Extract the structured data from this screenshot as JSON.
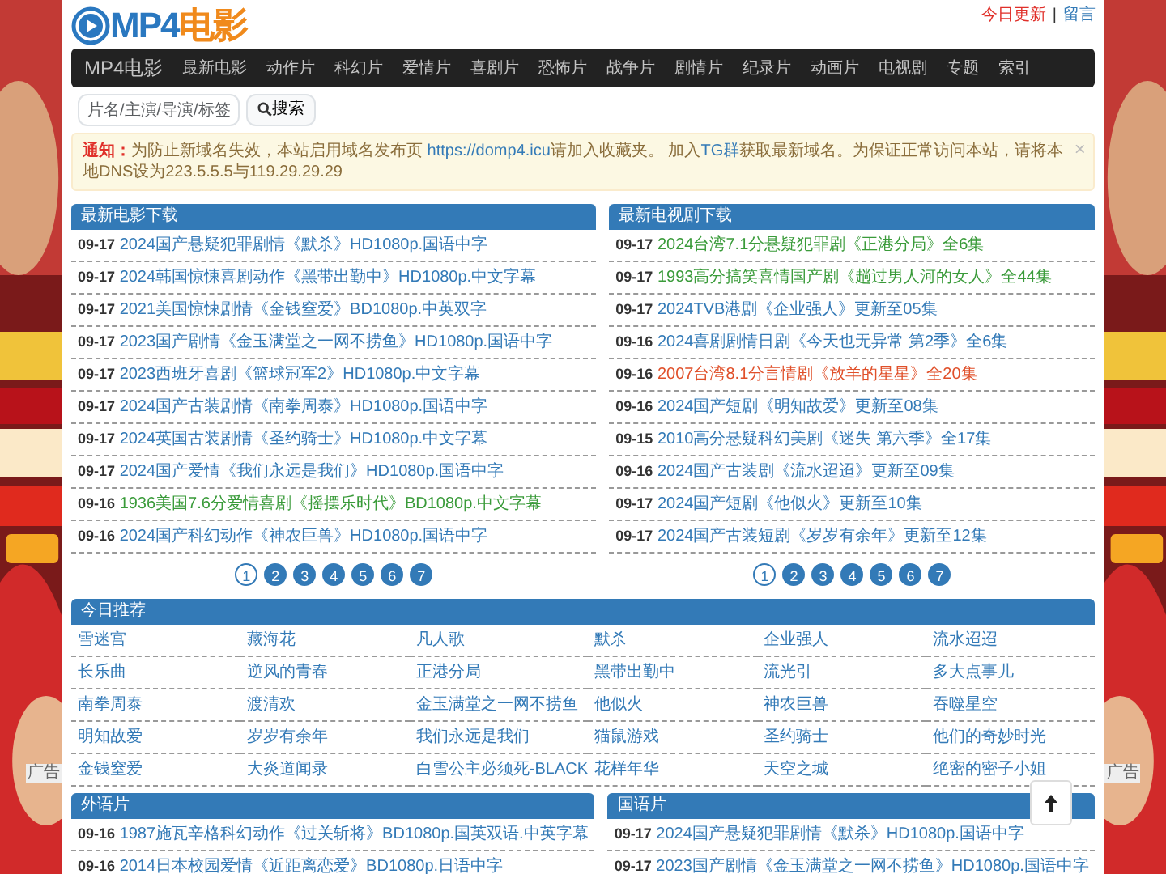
{
  "logo": {
    "text_a": "MP4",
    "text_b": "电影"
  },
  "top_links": [
    {
      "label": "今日更新",
      "color": "#e0302a"
    },
    {
      "label": "留言",
      "color": "#337ab7"
    }
  ],
  "top_separator": "|",
  "navbar": {
    "brand": "MP4电影",
    "items": [
      "最新电影",
      "动作片",
      "科幻片",
      "爱情片",
      "喜剧片",
      "恐怖片",
      "战争片",
      "剧情片",
      "纪录片",
      "动画片",
      "电视剧",
      "专题",
      "索引"
    ]
  },
  "search": {
    "placeholder": "片名/主演/导演/标签",
    "button": "搜索"
  },
  "notice": {
    "close": "×",
    "parts": [
      {
        "kind": "label",
        "text": "通知："
      },
      {
        "kind": "text",
        "text": "为防止新域名失效，本站启用域名发布页 "
      },
      {
        "kind": "link",
        "text": "https://domp4.icu"
      },
      {
        "kind": "text",
        "text": "请加入收藏夹。 加入"
      },
      {
        "kind": "link",
        "text": "TG群"
      },
      {
        "kind": "text",
        "text": "获取最新域名。为保证正常访问本站，请将本地DNS设为223.5.5.5与119.29.29.29"
      }
    ]
  },
  "movies": {
    "title": "最新电影下载",
    "rows": [
      {
        "date": "09-17",
        "title": "2024国产悬疑犯罪剧情《默杀》HD1080p.国语中字",
        "color": "#337ab7"
      },
      {
        "date": "09-17",
        "title": "2024韩国惊悚喜剧动作《黑带出勤中》HD1080p.中文字幕",
        "color": "#337ab7"
      },
      {
        "date": "09-17",
        "title": "2021美国惊悚剧情《金钱窒爱》BD1080p.中英双字",
        "color": "#337ab7"
      },
      {
        "date": "09-17",
        "title": "2023国产剧情《金玉满堂之一网不捞鱼》HD1080p.国语中字",
        "color": "#337ab7"
      },
      {
        "date": "09-17",
        "title": "2023西班牙喜剧《篮球冠军2》HD1080p.中文字幕",
        "color": "#337ab7"
      },
      {
        "date": "09-17",
        "title": "2024国产古装剧情《南拳周泰》HD1080p.国语中字",
        "color": "#337ab7"
      },
      {
        "date": "09-17",
        "title": "2024英国古装剧情《圣约骑士》HD1080p.中文字幕",
        "color": "#337ab7"
      },
      {
        "date": "09-17",
        "title": "2024国产爱情《我们永远是我们》HD1080p.国语中字",
        "color": "#337ab7"
      },
      {
        "date": "09-16",
        "title": "1936美国7.6分爱情喜剧《摇摆乐时代》BD1080p.中文字幕",
        "color": "#3a9b3a"
      },
      {
        "date": "09-16",
        "title": "2024国产科幻动作《神农巨兽》HD1080p.国语中字",
        "color": "#337ab7"
      }
    ],
    "pages": [
      {
        "label": "1",
        "selected": true
      },
      {
        "label": "2",
        "selected": false
      },
      {
        "label": "3",
        "selected": false
      },
      {
        "label": "4",
        "selected": false
      },
      {
        "label": "5",
        "selected": false
      },
      {
        "label": "6",
        "selected": false
      },
      {
        "label": "7",
        "selected": false
      }
    ]
  },
  "tv": {
    "title": "最新电视剧下载",
    "rows": [
      {
        "date": "09-17",
        "title": "2024台湾7.1分悬疑犯罪剧《正港分局》全6集",
        "color": "#3a9b3a"
      },
      {
        "date": "09-17",
        "title": "1993高分搞笑喜情国产剧《趟过男人河的女人》全44集",
        "color": "#3a9b3a"
      },
      {
        "date": "09-17",
        "title": "2024TVB港剧《企业强人》更新至05集",
        "color": "#337ab7"
      },
      {
        "date": "09-16",
        "title": "2024喜剧剧情日剧《今天也无异常 第2季》全6集",
        "color": "#337ab7"
      },
      {
        "date": "09-16",
        "title": "2007台湾8.1分言情剧《放羊的星星》全20集",
        "color": "#e0502a"
      },
      {
        "date": "09-16",
        "title": "2024国产短剧《明知故爱》更新至08集",
        "color": "#337ab7"
      },
      {
        "date": "09-15",
        "title": "2010高分悬疑科幻美剧《迷失 第六季》全17集",
        "color": "#337ab7"
      },
      {
        "date": "09-16",
        "title": "2024国产古装剧《流水迢迢》更新至09集",
        "color": "#337ab7"
      },
      {
        "date": "09-17",
        "title": "2024国产短剧《他似火》更新至10集",
        "color": "#337ab7"
      },
      {
        "date": "09-17",
        "title": "2024国产古装短剧《岁岁有余年》更新至12集",
        "color": "#337ab7"
      }
    ],
    "pages": [
      {
        "label": "1",
        "selected": true
      },
      {
        "label": "2",
        "selected": false
      },
      {
        "label": "3",
        "selected": false
      },
      {
        "label": "4",
        "selected": false
      },
      {
        "label": "5",
        "selected": false
      },
      {
        "label": "6",
        "selected": false
      },
      {
        "label": "7",
        "selected": false
      }
    ]
  },
  "today": {
    "title": "今日推荐",
    "items": [
      "雪迷宫",
      "藏海花",
      "凡人歌",
      "默杀",
      "企业强人",
      "流水迢迢",
      "长乐曲",
      "逆风的青春",
      "正港分局",
      "黑带出勤中",
      "流光引",
      "多大点事儿",
      "南拳周泰",
      "渡清欢",
      "金玉满堂之一网不捞鱼",
      "他似火",
      "神农巨兽",
      "吞噬星空",
      "明知故爱",
      "岁岁有余年",
      "我们永远是我们",
      "猫鼠游戏",
      "圣约骑士",
      "他们的奇妙时光",
      "金钱窒爱",
      "大炎道闻录",
      "白雪公主必须死-BLACK",
      "花样年华",
      "天空之城",
      "绝密的密子小姐"
    ]
  },
  "foreign": {
    "title": "外语片",
    "rows": [
      {
        "date": "09-16",
        "title": "1987施瓦辛格科幻动作《过关斩将》BD1080p.国英双语.中英字幕",
        "color": "#337ab7"
      },
      {
        "date": "09-16",
        "title": "2014日本校园爱情《近距离恋爱》BD1080p.日语中字",
        "color": "#337ab7"
      }
    ]
  },
  "mandarin": {
    "title": "国语片",
    "rows": [
      {
        "date": "09-17",
        "title": "2024国产悬疑犯罪剧情《默杀》HD1080p.国语中字",
        "color": "#337ab7"
      },
      {
        "date": "09-17",
        "title": "2023国产剧情《金玉满堂之一网不捞鱼》HD1080p.国语中字",
        "color": "#337ab7"
      }
    ]
  },
  "ads": [
    {
      "kind": "picture",
      "label": "广告"
    },
    {
      "kind": "picture",
      "label": "广告"
    }
  ]
}
